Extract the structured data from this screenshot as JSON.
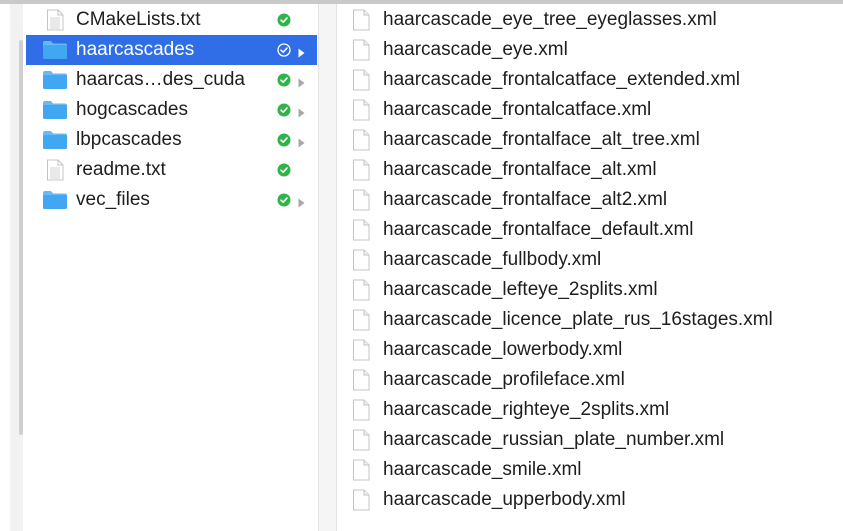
{
  "colors": {
    "selection": "#2f6ee6",
    "folder": "#42a7f2",
    "status_green": "#30b44a",
    "chevron": "#a8a8a8"
  },
  "left_column": {
    "items": [
      {
        "label": "CMakeLists.txt",
        "kind": "file",
        "icon": "text-document-icon",
        "status": "synced-check-icon",
        "has_children": false,
        "selected": false
      },
      {
        "label": "haarcascades",
        "kind": "folder",
        "icon": "folder-icon",
        "status": "synced-check-icon",
        "has_children": true,
        "selected": true
      },
      {
        "label": "haarcas…des_cuda",
        "kind": "folder",
        "icon": "folder-icon",
        "status": "synced-check-icon",
        "has_children": true,
        "selected": false
      },
      {
        "label": "hogcascades",
        "kind": "folder",
        "icon": "folder-icon",
        "status": "synced-check-icon",
        "has_children": true,
        "selected": false
      },
      {
        "label": "lbpcascades",
        "kind": "folder",
        "icon": "folder-icon",
        "status": "synced-check-icon",
        "has_children": true,
        "selected": false
      },
      {
        "label": "readme.txt",
        "kind": "file",
        "icon": "text-document-icon",
        "status": "synced-check-icon",
        "has_children": false,
        "selected": false
      },
      {
        "label": "vec_files",
        "kind": "folder",
        "icon": "folder-icon",
        "status": "synced-check-icon",
        "has_children": true,
        "selected": false
      }
    ]
  },
  "right_column": {
    "items": [
      {
        "label": "haarcascade_eye_tree_eyeglasses.xml",
        "icon": "blank-document-icon"
      },
      {
        "label": "haarcascade_eye.xml",
        "icon": "blank-document-icon"
      },
      {
        "label": "haarcascade_frontalcatface_extended.xml",
        "icon": "blank-document-icon"
      },
      {
        "label": "haarcascade_frontalcatface.xml",
        "icon": "blank-document-icon"
      },
      {
        "label": "haarcascade_frontalface_alt_tree.xml",
        "icon": "blank-document-icon"
      },
      {
        "label": "haarcascade_frontalface_alt.xml",
        "icon": "blank-document-icon"
      },
      {
        "label": "haarcascade_frontalface_alt2.xml",
        "icon": "blank-document-icon"
      },
      {
        "label": "haarcascade_frontalface_default.xml",
        "icon": "blank-document-icon"
      },
      {
        "label": "haarcascade_fullbody.xml",
        "icon": "blank-document-icon"
      },
      {
        "label": "haarcascade_lefteye_2splits.xml",
        "icon": "blank-document-icon"
      },
      {
        "label": "haarcascade_licence_plate_rus_16stages.xml",
        "icon": "blank-document-icon"
      },
      {
        "label": "haarcascade_lowerbody.xml",
        "icon": "blank-document-icon"
      },
      {
        "label": "haarcascade_profileface.xml",
        "icon": "blank-document-icon"
      },
      {
        "label": "haarcascade_righteye_2splits.xml",
        "icon": "blank-document-icon"
      },
      {
        "label": "haarcascade_russian_plate_number.xml",
        "icon": "blank-document-icon"
      },
      {
        "label": "haarcascade_smile.xml",
        "icon": "blank-document-icon"
      },
      {
        "label": "haarcascade_upperbody.xml",
        "icon": "blank-document-icon"
      }
    ]
  }
}
